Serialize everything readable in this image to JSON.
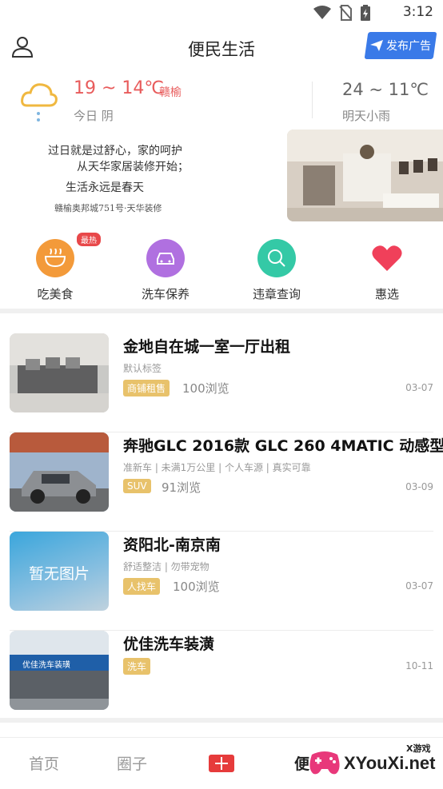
{
  "status_bar": {
    "time": "3:12"
  },
  "header": {
    "title": "便民生活",
    "post_ad_label": "发布广告"
  },
  "weather": {
    "today_temp": "19 ~ 14℃",
    "city": "赣榆",
    "today_desc": "今日 阴",
    "tomorrow_temp": "24 ~ 11℃",
    "tomorrow_desc": "明天小雨"
  },
  "banner": {
    "line1": "过日就是过舒心，家的呵护",
    "line2": "从天华家居装修开始；",
    "line3": "生活永远是春天",
    "line4": "赣榆奥邦城751号·天华装修"
  },
  "quick_nav": [
    {
      "label": "吃美食",
      "icon": "bowl-icon",
      "badge": "最热",
      "color": "#f39a3a"
    },
    {
      "label": "洗车保养",
      "icon": "car-icon",
      "color": "#b070e0"
    },
    {
      "label": "违章查询",
      "icon": "search-icon",
      "color": "#34c9a6"
    },
    {
      "label": "惠选",
      "icon": "heart-icon",
      "color": "#f0405a"
    }
  ],
  "listings": [
    {
      "title": "金地自在城一室一厅出租",
      "subtitle": "默认标签",
      "tag": "商铺租售",
      "views": "100浏览",
      "date": "03-07"
    },
    {
      "title": "奔驰GLC 2016款 GLC 260 4MATIC 动感型",
      "subtitle": "准新车 | 未满1万公里 | 个人车源 | 真实可靠",
      "tag": "SUV",
      "views": "91浏览",
      "date": "03-09"
    },
    {
      "title": "资阳北-南京南",
      "subtitle": "舒适整洁 | 勿带宠物",
      "tag": "人找车",
      "views": "100浏览",
      "date": "03-07",
      "thumb_text": "暂无图片"
    },
    {
      "title": "优佳洗车装潢",
      "subtitle": "",
      "tag": "洗车",
      "views": "",
      "date": "10-11",
      "thumb_text": "优佳洗车装璜"
    }
  ],
  "tab_bar": {
    "home": "首页",
    "circle": "圈子",
    "life": "便"
  },
  "watermark": {
    "brand": "XYouXi.net",
    "small": "X游戏"
  }
}
